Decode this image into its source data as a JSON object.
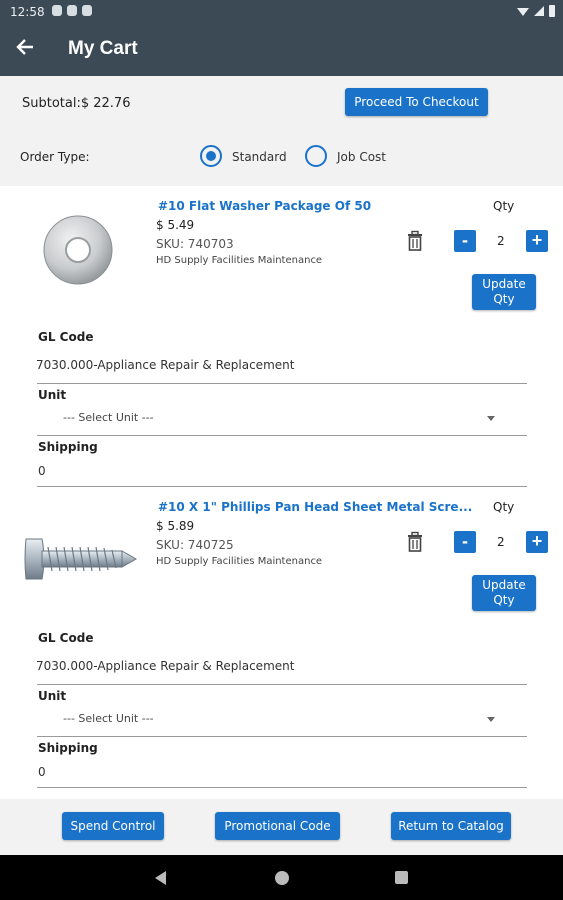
{
  "status_bar": {
    "time": "12:58"
  },
  "header": {
    "title": "My Cart"
  },
  "summary": {
    "subtotal": "Subtotal:$ 22.76",
    "checkout_label": "Proceed To Checkout",
    "order_type_label": "Order Type:",
    "options": [
      {
        "label": "Standard",
        "selected": true
      },
      {
        "label": "Job Cost",
        "selected": false
      }
    ]
  },
  "items": [
    {
      "name": "#10 Flat Washer Package Of 50",
      "price": "$ 5.49",
      "sku": "SKU: 740703",
      "vendor": "HD Supply Facilities Maintenance",
      "qty_label": "Qty",
      "qty": "2",
      "update_label": "Update Qty",
      "gl_code_label": "GL Code",
      "gl_code_value": "7030.000-Appliance Repair & Replacement",
      "unit_label": "Unit",
      "unit_placeholder": "--- Select Unit ---",
      "shipping_label": "Shipping",
      "shipping_value": "0"
    },
    {
      "name": "#10 X 1\" Phillips Pan Head Sheet Metal Scre...",
      "price": "$ 5.89",
      "sku": "SKU: 740725",
      "vendor": "HD Supply Facilities Maintenance",
      "qty_label": "Qty",
      "qty": "2",
      "update_label": "Update Qty",
      "gl_code_label": "GL Code",
      "gl_code_value": "7030.000-Appliance Repair & Replacement",
      "unit_label": "Unit",
      "unit_placeholder": "--- Select Unit ---",
      "shipping_label": "Shipping",
      "shipping_value": "0"
    }
  ],
  "footer": {
    "spend_control": "Spend Control",
    "promo_code": "Promotional Code",
    "return_catalog": "Return to Catalog"
  },
  "colors": {
    "app_bar": "#3b4a54",
    "accent": "#1a73c9"
  }
}
